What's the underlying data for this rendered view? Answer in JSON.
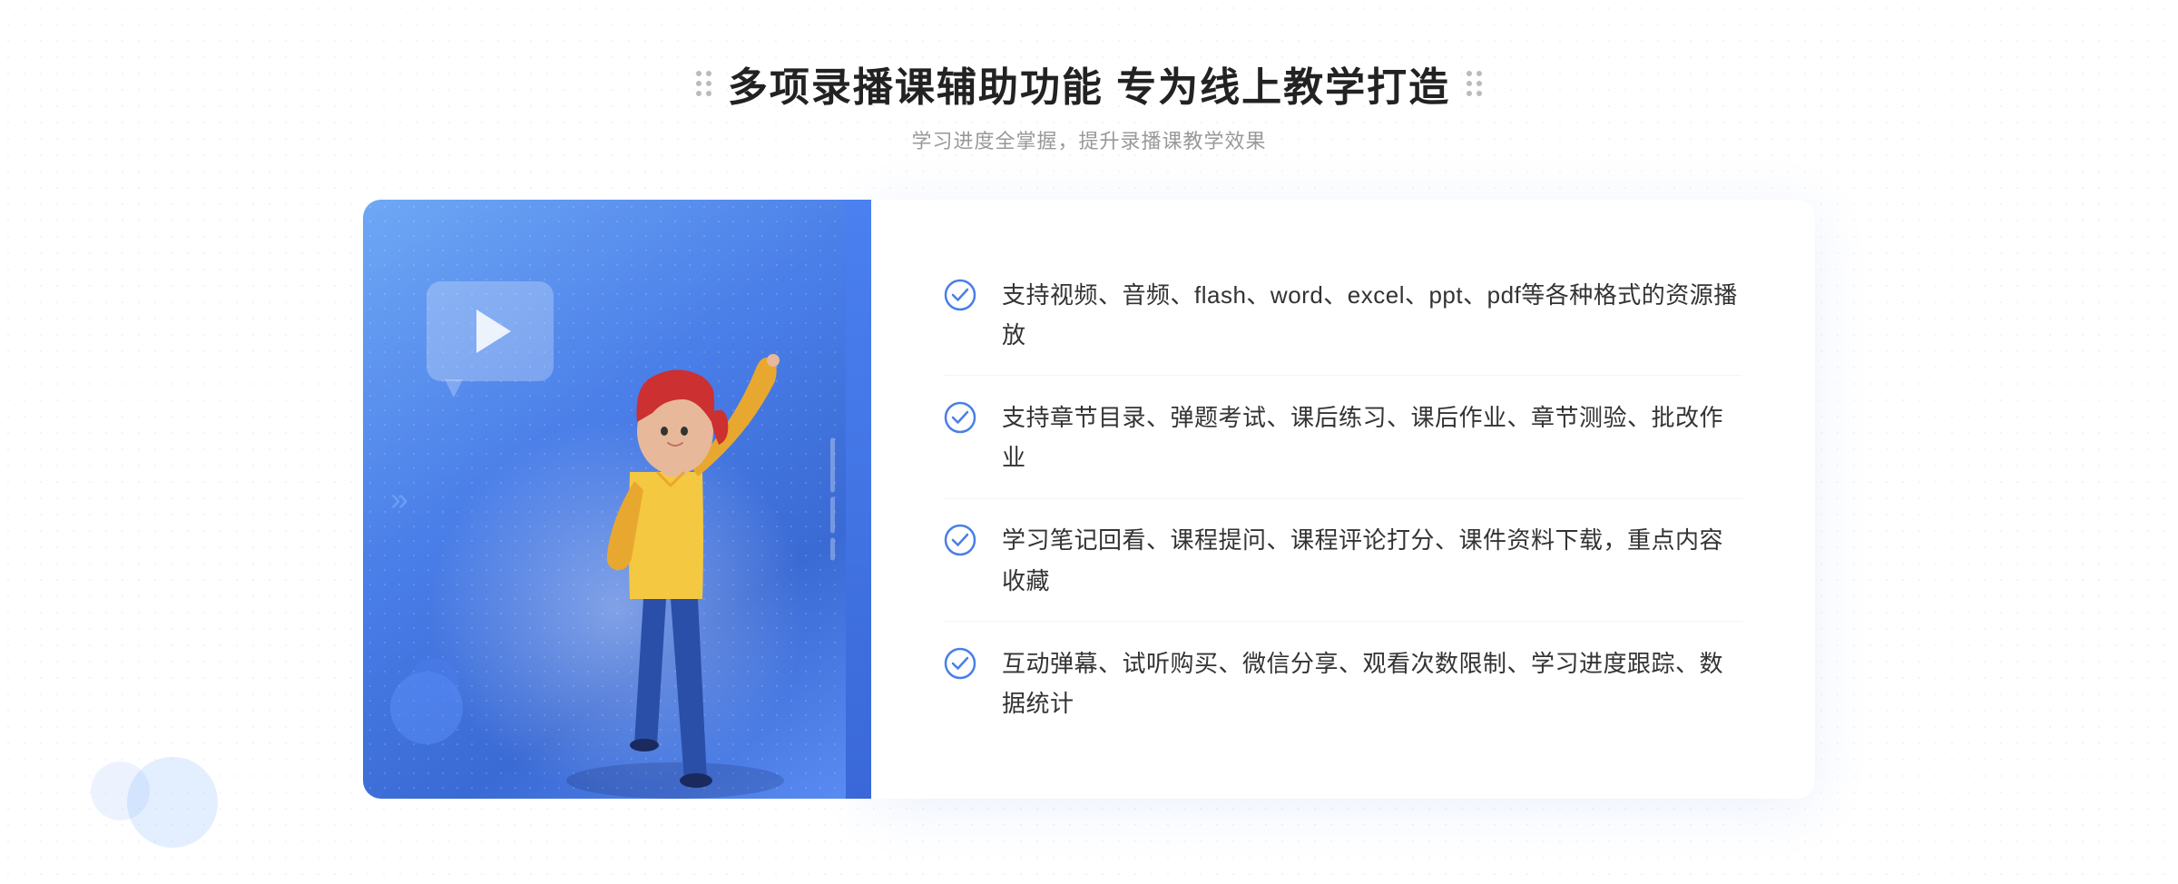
{
  "header": {
    "title": "多项录播课辅助功能 专为线上教学打造",
    "subtitle": "学习进度全掌握，提升录播课教学效果",
    "decorLeft": "⁞",
    "decorRight": "⁞"
  },
  "features": [
    {
      "id": "feature-1",
      "text": "支持视频、音频、flash、word、excel、ppt、pdf等各种格式的资源播放"
    },
    {
      "id": "feature-2",
      "text": "支持章节目录、弹题考试、课后练习、课后作业、章节测验、批改作业"
    },
    {
      "id": "feature-3",
      "text": "学习笔记回看、课程提问、课程评论打分、课件资料下载，重点内容收藏"
    },
    {
      "id": "feature-4",
      "text": "互动弹幕、试听购买、微信分享、观看次数限制、学习进度跟踪、数据统计"
    }
  ],
  "colors": {
    "accent": "#4a7ee8",
    "checkColor": "#4a7ee8",
    "titleColor": "#222222",
    "subtitleColor": "#999999",
    "textColor": "#333333"
  },
  "chevrons": "»",
  "leftChevrons": "«"
}
